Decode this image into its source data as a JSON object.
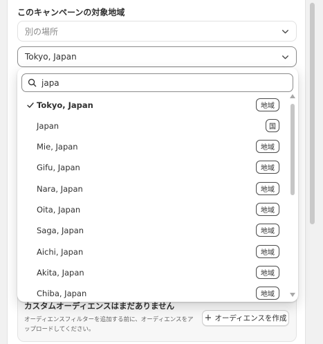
{
  "section_label": "このキャンペーンの対象地域",
  "location_select": {
    "placeholder": "別の場所"
  },
  "region_select": {
    "value": "Tokyo, Japan"
  },
  "search": {
    "value": "japa"
  },
  "results": [
    {
      "label": "Tokyo, Japan",
      "badge": "地域",
      "selected": true
    },
    {
      "label": "Japan",
      "badge": "国",
      "selected": false
    },
    {
      "label": "Mie, Japan",
      "badge": "地域",
      "selected": false
    },
    {
      "label": "Gifu, Japan",
      "badge": "地域",
      "selected": false
    },
    {
      "label": "Nara, Japan",
      "badge": "地域",
      "selected": false
    },
    {
      "label": "Oita, Japan",
      "badge": "地域",
      "selected": false
    },
    {
      "label": "Saga, Japan",
      "badge": "地域",
      "selected": false
    },
    {
      "label": "Aichi, Japan",
      "badge": "地域",
      "selected": false
    },
    {
      "label": "Akita, Japan",
      "badge": "地域",
      "selected": false
    },
    {
      "label": "Chiba, Japan",
      "badge": "地域",
      "selected": false
    }
  ],
  "audience_card": {
    "title": "カスタムオーディエンスはまだありません",
    "description": "オーディエンスフィルターを追加する前に、オーディエンスをアップロードしてください。",
    "button_label": "オーディエンスを作成"
  },
  "icons": {
    "check": "checkmark-icon",
    "search": "search-icon",
    "chevron": "chevron-down-icon",
    "plus": "plus-icon"
  },
  "colors": {
    "text": "#303030",
    "muted": "#8a8a8a",
    "border": "#d0d0d0",
    "surface": "#f7f7f7"
  }
}
